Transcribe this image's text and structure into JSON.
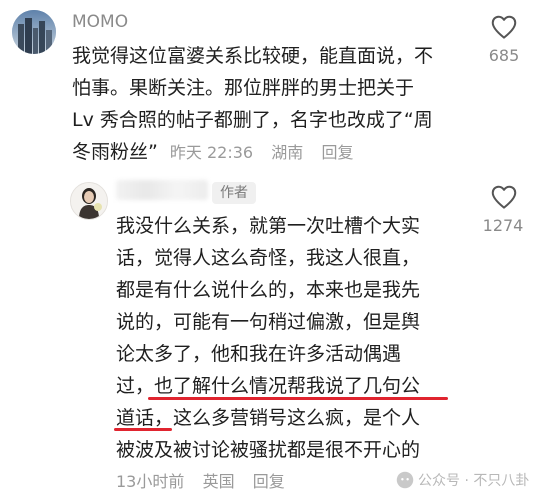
{
  "comment1": {
    "username": "MOMO",
    "lines": [
      "我觉得这位富婆关系比较硬，能直面说，不",
      "怕事。果断关注。那位胖胖的男士把关于",
      "Lv 秀合照的帖子都删了，名字也改成了“周",
      "冬雨粉丝”"
    ],
    "time": "昨天 22:36",
    "location": "湖南",
    "reply_label": "回复",
    "like_count": "685"
  },
  "comment2": {
    "badge": "作者",
    "lines": [
      "我没什么关系，就第一次吐槽个大实",
      "话，觉得人这么奇怪，我这人很直，",
      "都是有什么说什么的，本来也是我先",
      "说的，可能有一句稍过偏激，但是舆",
      "论太多了，他和我在许多活动偶遇",
      "过，也了解什么情况帮我说了几句公",
      "道话，这么多营销号这么疯，是个人",
      "被波及被讨论被骚扰都是很不开心的"
    ],
    "time": "13小时前",
    "location": "英国",
    "reply_label": "回复",
    "like_count": "1274"
  },
  "watermark": {
    "text": "公众号 · 不只八卦"
  },
  "colors": {
    "highlight_underline": "#e0242f",
    "text": "#1f1f1f",
    "meta": "#9a9a9a"
  }
}
